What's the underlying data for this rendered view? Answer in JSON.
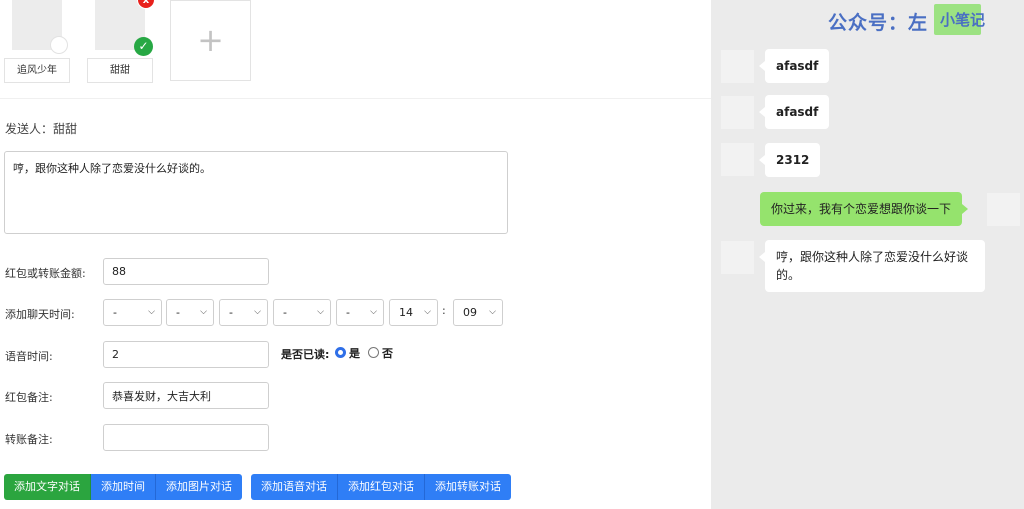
{
  "editor": {
    "avatars": [
      {
        "name": "追风少年",
        "selected": false
      },
      {
        "name": "甜甜",
        "selected": true
      }
    ],
    "delete_badge": "x",
    "add_symbol": "+",
    "check_symbol": "✓",
    "sender": "发送人：甜甜",
    "message_text": "哼，跟你这种人除了恋爱没什么好谈的。",
    "amount_label": "红包或转账金额:",
    "amount_value": "88",
    "chat_time_label": "添加聊天时间:",
    "time_selects": [
      "-",
      "-",
      "-",
      "-",
      "-",
      "14",
      "09"
    ],
    "time_colon": ":",
    "voice_time_label": "语音时间:",
    "voice_time_value": "2",
    "read_label": "是否已读:",
    "read_yes": "是",
    "read_no": "否",
    "read_selected": "是",
    "redpack_note_label": "红包备注:",
    "redpack_note_value": "恭喜发财，大吉大利",
    "transfer_note_label": "转账备注:",
    "transfer_note_value": "",
    "buttons_group1": [
      "添加文字对话",
      "添加时间",
      "添加图片对话"
    ],
    "buttons_group2": [
      "添加语音对话",
      "添加红包对话",
      "添加转账对话"
    ],
    "colors": {
      "primary": "#2f7ef6",
      "success": "#2ba53f",
      "danger": "#e8211c"
    }
  },
  "preview": {
    "watermark": "公众号：左",
    "watermark_overlay": "小笔记",
    "messages": [
      {
        "side": "left",
        "text": "afasdf"
      },
      {
        "side": "left",
        "text": "afasdf"
      },
      {
        "side": "left",
        "text": "2312"
      },
      {
        "side": "right",
        "text": "你过来，我有个恋爱想跟你谈一下"
      },
      {
        "side": "left",
        "text": "哼，跟你这种人除了恋爱没什么好谈的。"
      }
    ],
    "colors": {
      "background": "#ebebeb",
      "self_bubble": "#95e36d",
      "watermark": "#4a6fc3"
    }
  }
}
